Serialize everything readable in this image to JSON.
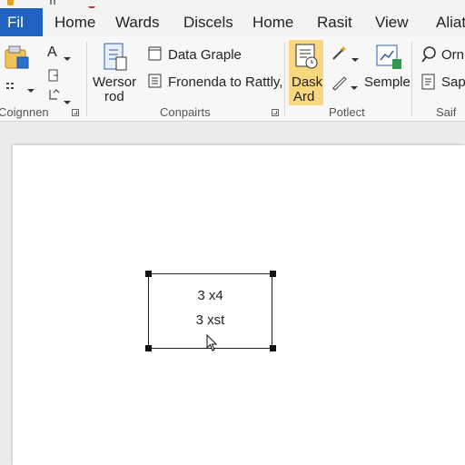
{
  "tabs": {
    "file": "Fil",
    "items": [
      "Home",
      "Wards",
      "Discels",
      "Home",
      "Rasit",
      "View",
      "Aliati"
    ]
  },
  "ribbon": {
    "group1": {
      "a_label": "A",
      "label": "Coignnen"
    },
    "group2": {
      "big_button": "Wersor\nrod",
      "big_line1": "Wersor",
      "big_line2": "rod",
      "data_graple": "Data Graple",
      "fronenda": "Fronenda to Rattly,",
      "label": "Conpairts"
    },
    "group3": {
      "dask_line1": "Dask",
      "dask_line2": "Ard",
      "semple": "Semple",
      "label": "Potlect"
    },
    "group4": {
      "orn": "Orn",
      "sap": "Sap",
      "label": "Saif"
    }
  },
  "document": {
    "box_line1": "3 x4",
    "box_line2": "3 xst"
  },
  "colors": {
    "file_tab": "#1f63bf",
    "highlight": "#f8d77f",
    "accent_green": "#2e9b4f"
  },
  "icons": [
    "folder-icon",
    "clipboard-icon",
    "document-icon",
    "chart-icon",
    "magic-wand-icon",
    "pencil-icon",
    "search-icon",
    "cursor-icon"
  ]
}
